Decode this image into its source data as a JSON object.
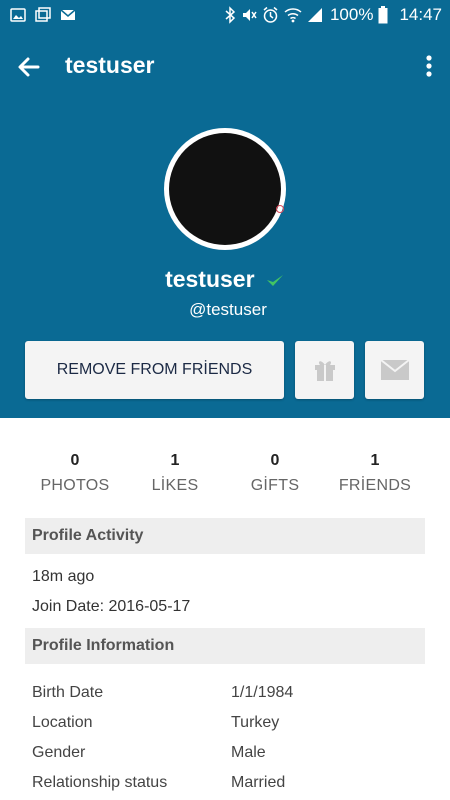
{
  "status_bar": {
    "battery": "100%",
    "time": "14:47",
    "icons_left": [
      "image-icon",
      "multiwindow-icon",
      "mail-icon"
    ],
    "icons_right": [
      "bluetooth-icon",
      "mute-icon",
      "alarm-icon",
      "wifi-icon",
      "signal-icon",
      "battery-icon"
    ]
  },
  "app_bar": {
    "title": "testuser"
  },
  "profile": {
    "display_name": "testuser",
    "handle": "@testuser",
    "verified_color": "#43c463"
  },
  "actions": {
    "remove_friend_label": "REMOVE FROM FRİENDS"
  },
  "stats": [
    {
      "value": "0",
      "label": "PHOTOS"
    },
    {
      "value": "1",
      "label": "LİKES"
    },
    {
      "value": "0",
      "label": "GİFTS"
    },
    {
      "value": "1",
      "label": "FRİENDS"
    }
  ],
  "activity": {
    "title": "Profile Activity",
    "last_seen": "18m ago",
    "join_date": "Join Date: 2016-05-17"
  },
  "information": {
    "title": "Profile Information",
    "rows": [
      {
        "label": "Birth Date",
        "value": "1/1/1984"
      },
      {
        "label": "Location",
        "value": "Turkey"
      },
      {
        "label": "Gender",
        "value": "Male"
      },
      {
        "label": "Relationship status",
        "value": "Married"
      }
    ]
  },
  "colors": {
    "primary": "#0a6a94",
    "section_bg": "#eeeeee"
  }
}
